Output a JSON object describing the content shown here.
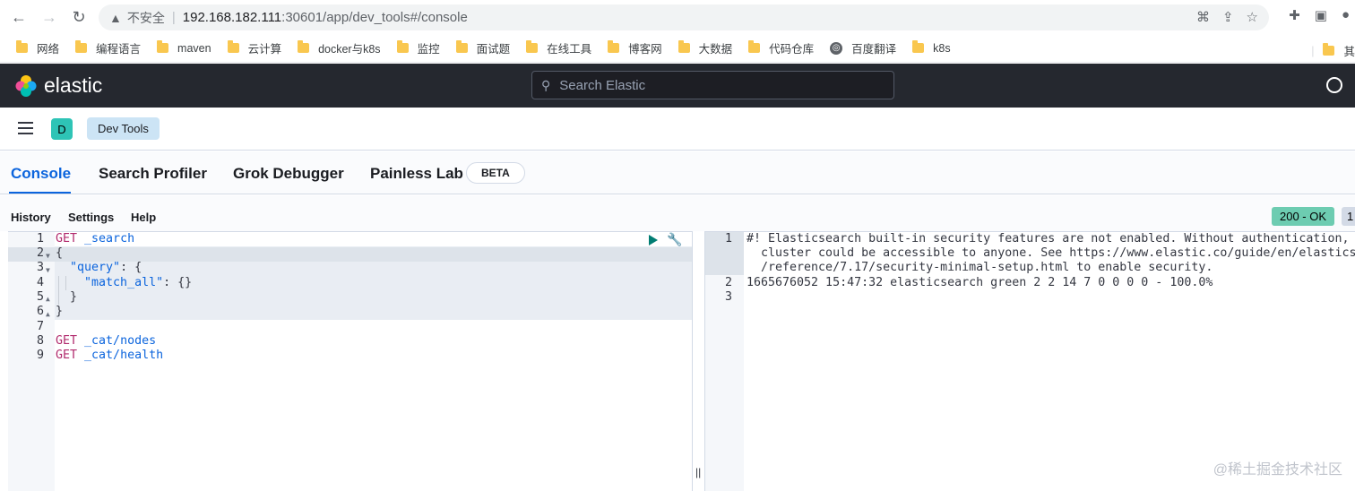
{
  "browser": {
    "insecure_label": "不安全",
    "url_host": "192.168.182.111",
    "url_path": ":30601/app/dev_tools#/console",
    "bookmarks": [
      "网络",
      "编程语言",
      "maven",
      "云计算",
      "docker与k8s",
      "监控",
      "面试题",
      "在线工具",
      "博客网",
      "大数据",
      "代码仓库",
      "百度翻译",
      "k8s"
    ],
    "bookmark_overflow": "其"
  },
  "header": {
    "brand": "elastic",
    "search_placeholder": "Search Elastic"
  },
  "breadcrumb": {
    "space_initial": "D",
    "current": "Dev Tools"
  },
  "tabs": [
    {
      "label": "Console",
      "active": true
    },
    {
      "label": "Search Profiler",
      "active": false
    },
    {
      "label": "Grok Debugger",
      "active": false
    },
    {
      "label": "Painless Lab",
      "active": false
    }
  ],
  "beta_badge": "BETA",
  "toolbar": {
    "history": "History",
    "settings": "Settings",
    "help": "Help",
    "status": "200 - OK",
    "time": "1"
  },
  "editor": {
    "line_numbers": [
      "1",
      "2",
      "3",
      "4",
      "5",
      "6",
      "7",
      "8",
      "9"
    ],
    "req1_method": "GET",
    "req1_path": " _search",
    "l2": "{",
    "l3_key": "\"query\"",
    "l3_rest": ": {",
    "l4_key": "\"match_all\"",
    "l4_rest": ": {}",
    "l5": "}",
    "l6": "}",
    "req2_method": "GET",
    "req2_path": " _cat/nodes",
    "req3_method": "GET",
    "req3_path": " _cat/health"
  },
  "output": {
    "line_numbers": [
      "1",
      "2",
      "3"
    ],
    "line1a": "#! Elasticsearch built-in security features are not enabled. Without authentication, yo",
    "line1b": "  cluster could be accessible to anyone. See https://www.elastic.co/guide/en/elasticsea",
    "line1c": "  /reference/7.17/security-minimal-setup.html to enable security.",
    "line2": "1665676052 15:47:32 elasticsearch green 2 2 14 7 0 0 0 0 - 100.0%",
    "line3": ""
  },
  "watermark": "@稀土掘金技术社区",
  "colors": {
    "header_bg": "#25282f",
    "accent": "#0b64dd",
    "status_ok": "#6dccb1",
    "method": "#b12a6d",
    "play": "#017d73"
  }
}
